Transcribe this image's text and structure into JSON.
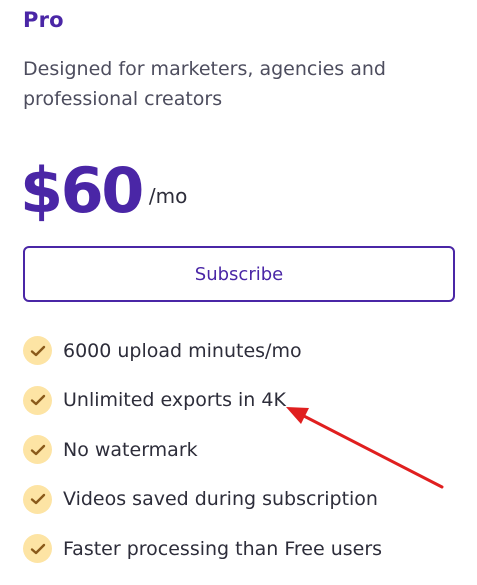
{
  "plan": {
    "name": "Pro",
    "description": "Designed for marketers, agencies and professional creators",
    "price": "$60",
    "period": "/mo",
    "subscribe_label": "Subscribe"
  },
  "features": [
    {
      "label": "6000 upload minutes/mo",
      "icon": "check-icon"
    },
    {
      "label": "Unlimited exports in 4K",
      "icon": "check-icon"
    },
    {
      "label": "No watermark",
      "icon": "check-icon"
    },
    {
      "label": "Videos saved during subscription",
      "icon": "check-icon"
    },
    {
      "label": "Faster processing than Free users",
      "icon": "check-icon"
    }
  ],
  "colors": {
    "brand": "#4a26a6",
    "check_bg": "#fde4a4",
    "check_mark": "#8a5a1a",
    "annotation": "#e01f1f"
  }
}
